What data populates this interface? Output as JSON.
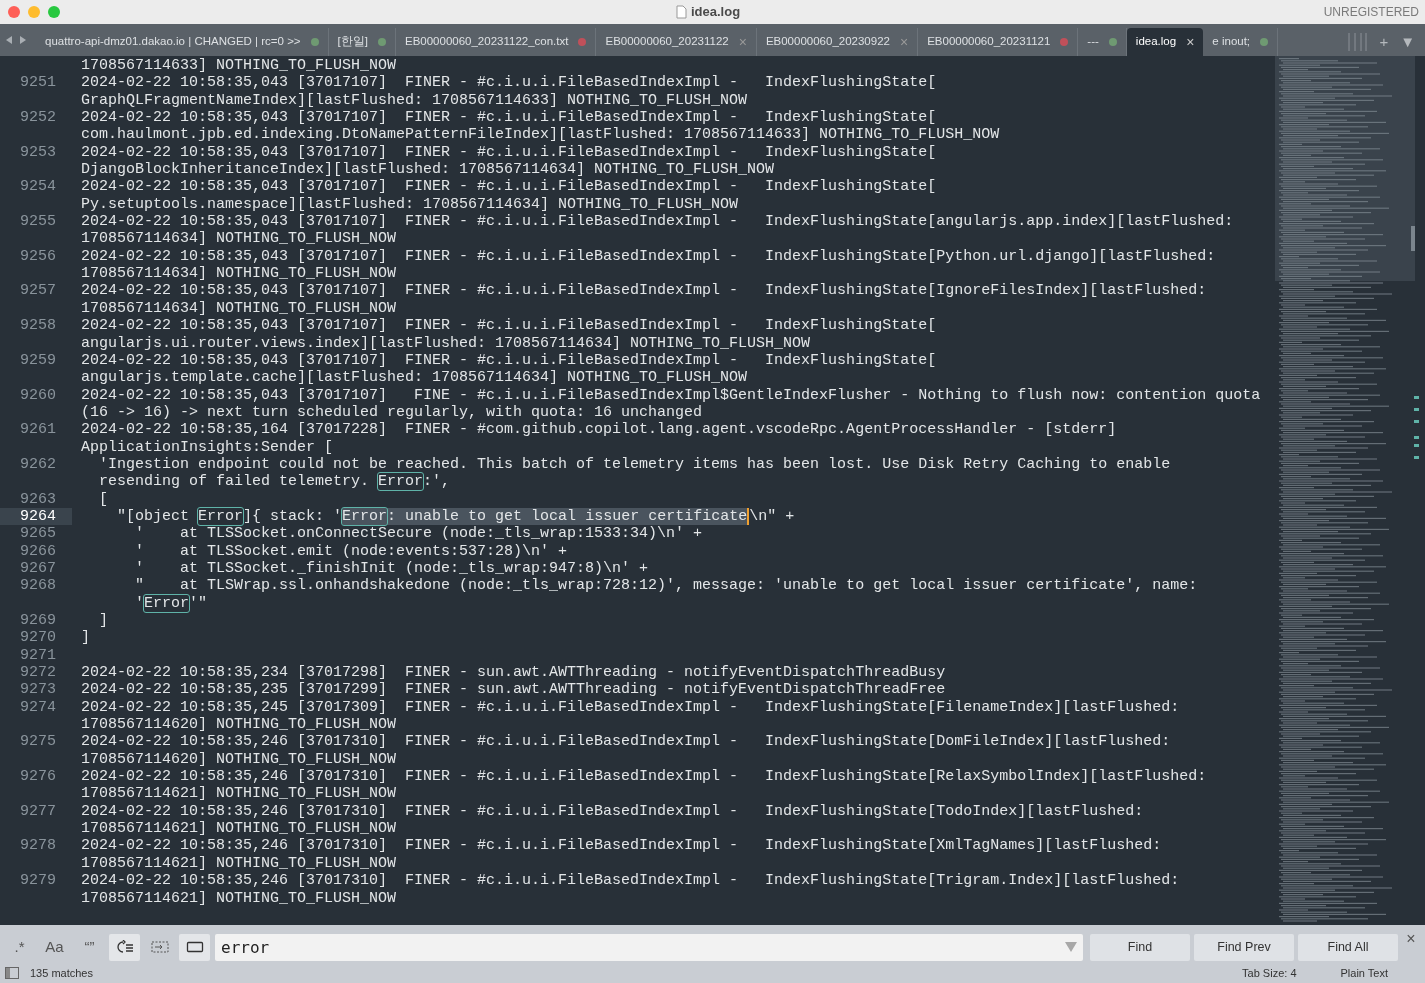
{
  "window": {
    "title": "idea.log",
    "registration": "UNREGISTERED"
  },
  "tabs": [
    {
      "label": "quattro-api-dmz01.dakao.io | CHANGED | rc=0 >>",
      "selected": false,
      "kind": "dot",
      "color": "#6f9a72"
    },
    {
      "label": "[한일]",
      "selected": false,
      "kind": "dot",
      "color": "#6f9a72"
    },
    {
      "label": "EB00000060_20231122_con.txt",
      "selected": false,
      "kind": "dot",
      "color": "#c0505a"
    },
    {
      "label": "EB00000060_20231122",
      "selected": false,
      "kind": "close",
      "close": "×"
    },
    {
      "label": "EB00000060_20230922",
      "selected": false,
      "kind": "close",
      "close": "×"
    },
    {
      "label": "EB00000060_20231121",
      "selected": false,
      "kind": "dot",
      "color": "#c0505a"
    },
    {
      "label": "---",
      "selected": false,
      "kind": "dot",
      "color": "#6f9a72"
    },
    {
      "label": "idea.log",
      "selected": true,
      "kind": "close",
      "close": "×"
    },
    {
      "label": "e inout;",
      "selected": false,
      "kind": "dot",
      "color": "#6f9a72"
    }
  ],
  "tab_actions": [
    "+",
    "▼"
  ],
  "editor": {
    "rows": [
      {
        "segments": [
          {
            "text": "1708567114633] NOTHING_TO_FLUSH_NOW"
          }
        ]
      },
      {
        "number": "9251",
        "segments": [
          {
            "text": "2024-02-22 10:58:35,043 [37017107]  FINER - #c.i.u.i.FileBasedIndexImpl -   IndexFlushingState["
          }
        ]
      },
      {
        "segments": [
          {
            "text": "GraphQLFragmentNameIndex][lastFlushed: 1708567114633] NOTHING_TO_FLUSH_NOW"
          }
        ]
      },
      {
        "number": "9252",
        "segments": [
          {
            "text": "2024-02-22 10:58:35,043 [37017107]  FINER - #c.i.u.i.FileBasedIndexImpl -   IndexFlushingState["
          }
        ]
      },
      {
        "segments": [
          {
            "text": "com.haulmont.jpb.ed.indexing.DtoNamePatternFileIndex][lastFlushed: 1708567114633] NOTHING_TO_FLUSH_NOW"
          }
        ]
      },
      {
        "number": "9253",
        "segments": [
          {
            "text": "2024-02-22 10:58:35,043 [37017107]  FINER - #c.i.u.i.FileBasedIndexImpl -   IndexFlushingState["
          }
        ]
      },
      {
        "segments": [
          {
            "text": "DjangoBlockInheritanceIndex][lastFlushed: 1708567114634] NOTHING_TO_FLUSH_NOW"
          }
        ]
      },
      {
        "number": "9254",
        "segments": [
          {
            "text": "2024-02-22 10:58:35,043 [37017107]  FINER - #c.i.u.i.FileBasedIndexImpl -   IndexFlushingState["
          }
        ]
      },
      {
        "segments": [
          {
            "text": "Py.setuptools.namespace][lastFlushed: 1708567114634] NOTHING_TO_FLUSH_NOW"
          }
        ]
      },
      {
        "number": "9255",
        "segments": [
          {
            "text": "2024-02-22 10:58:35,043 [37017107]  FINER - #c.i.u.i.FileBasedIndexImpl -   IndexFlushingState[angularjs.app.index][lastFlushed:"
          }
        ]
      },
      {
        "segments": [
          {
            "text": "1708567114634] NOTHING_TO_FLUSH_NOW"
          }
        ]
      },
      {
        "number": "9256",
        "segments": [
          {
            "text": "2024-02-22 10:58:35,043 [37017107]  FINER - #c.i.u.i.FileBasedIndexImpl -   IndexFlushingState[Python.url.django][lastFlushed:"
          }
        ]
      },
      {
        "segments": [
          {
            "text": "1708567114634] NOTHING_TO_FLUSH_NOW"
          }
        ]
      },
      {
        "number": "9257",
        "segments": [
          {
            "text": "2024-02-22 10:58:35,043 [37017107]  FINER - #c.i.u.i.FileBasedIndexImpl -   IndexFlushingState[IgnoreFilesIndex][lastFlushed:"
          }
        ]
      },
      {
        "segments": [
          {
            "text": "1708567114634] NOTHING_TO_FLUSH_NOW"
          }
        ]
      },
      {
        "number": "9258",
        "segments": [
          {
            "text": "2024-02-22 10:58:35,043 [37017107]  FINER - #c.i.u.i.FileBasedIndexImpl -   IndexFlushingState["
          }
        ]
      },
      {
        "segments": [
          {
            "text": "angularjs.ui.router.views.index][lastFlushed: 1708567114634] NOTHING_TO_FLUSH_NOW"
          }
        ]
      },
      {
        "number": "9259",
        "segments": [
          {
            "text": "2024-02-22 10:58:35,043 [37017107]  FINER - #c.i.u.i.FileBasedIndexImpl -   IndexFlushingState["
          }
        ]
      },
      {
        "segments": [
          {
            "text": "angularjs.template.cache][lastFlushed: 1708567114634] NOTHING_TO_FLUSH_NOW"
          }
        ]
      },
      {
        "number": "9260",
        "segments": [
          {
            "text": "2024-02-22 10:58:35,043 [37017107]   FINE - #c.i.u.i.FileBasedIndexImpl$GentleIndexFlusher - Nothing to flush now: contention quota"
          }
        ]
      },
      {
        "segments": [
          {
            "text": "(16 -> 16) -> next turn scheduled regularly, with quota: 16 unchanged"
          }
        ]
      },
      {
        "number": "9261",
        "segments": [
          {
            "text": "2024-02-22 10:58:35,164 [37017228]  FINER - #com.github.copilot.lang.agent.vscodeRpc.AgentProcessHandler - [stderr]"
          }
        ]
      },
      {
        "segments": [
          {
            "text": "ApplicationInsights:Sender ["
          }
        ]
      },
      {
        "number": "9262",
        "segments": [
          {
            "text": "  'Ingestion endpoint could not be reached. This batch of telemetry items has been lost. Use Disk Retry Caching to enable"
          }
        ]
      },
      {
        "segments": [
          {
            "text": "  resending of failed telemetry. "
          },
          {
            "text": "Error",
            "kind": "match"
          },
          {
            "text": ":',"
          }
        ]
      },
      {
        "number": "9263",
        "segments": [
          {
            "text": "  ["
          }
        ]
      },
      {
        "number": "9264",
        "current": true,
        "segments": [
          {
            "text": "    \"[object "
          },
          {
            "text": "Error",
            "kind": "match"
          },
          {
            "text": "]{ stack: '"
          },
          {
            "text": "Error",
            "kind": "selected_match"
          },
          {
            "text": ": unable to get local issuer certificate",
            "kind": "selected",
            "caret": true
          },
          {
            "text": "\\n\" +"
          }
        ]
      },
      {
        "number": "9265",
        "segments": [
          {
            "text": "      '    at TLSSocket.onConnectSecure (node:_tls_wrap:1533:34)\\n' +"
          }
        ]
      },
      {
        "number": "9266",
        "segments": [
          {
            "text": "      '    at TLSSocket.emit (node:events:537:28)\\n' +"
          }
        ]
      },
      {
        "number": "9267",
        "segments": [
          {
            "text": "      '    at TLSSocket._finishInit (node:_tls_wrap:947:8)\\n' +"
          }
        ]
      },
      {
        "number": "9268",
        "segments": [
          {
            "text": "      \"    at TLSWrap.ssl.onhandshakedone (node:_tls_wrap:728:12)', message: 'unable to get local issuer certificate', name:"
          }
        ]
      },
      {
        "segments": [
          {
            "text": "      '"
          },
          {
            "text": "Error",
            "kind": "match"
          },
          {
            "text": "'\""
          }
        ]
      },
      {
        "number": "9269",
        "segments": [
          {
            "text": "  ]"
          }
        ]
      },
      {
        "number": "9270",
        "segments": [
          {
            "text": "]"
          }
        ]
      },
      {
        "number": "9271",
        "segments": []
      },
      {
        "number": "9272",
        "segments": [
          {
            "text": "2024-02-22 10:58:35,234 [37017298]  FINER - sun.awt.AWTThreading - notifyEventDispatchThreadBusy"
          }
        ]
      },
      {
        "number": "9273",
        "segments": [
          {
            "text": "2024-02-22 10:58:35,235 [37017299]  FINER - sun.awt.AWTThreading - notifyEventDispatchThreadFree"
          }
        ]
      },
      {
        "number": "9274",
        "segments": [
          {
            "text": "2024-02-22 10:58:35,245 [37017309]  FINER - #c.i.u.i.FileBasedIndexImpl -   IndexFlushingState[FilenameIndex][lastFlushed:"
          }
        ]
      },
      {
        "segments": [
          {
            "text": "1708567114620] NOTHING_TO_FLUSH_NOW"
          }
        ]
      },
      {
        "number": "9275",
        "segments": [
          {
            "text": "2024-02-22 10:58:35,246 [37017310]  FINER - #c.i.u.i.FileBasedIndexImpl -   IndexFlushingState[DomFileIndex][lastFlushed:"
          }
        ]
      },
      {
        "segments": [
          {
            "text": "1708567114620] NOTHING_TO_FLUSH_NOW"
          }
        ]
      },
      {
        "number": "9276",
        "segments": [
          {
            "text": "2024-02-22 10:58:35,246 [37017310]  FINER - #c.i.u.i.FileBasedIndexImpl -   IndexFlushingState[RelaxSymbolIndex][lastFlushed:"
          }
        ]
      },
      {
        "segments": [
          {
            "text": "1708567114621] NOTHING_TO_FLUSH_NOW"
          }
        ]
      },
      {
        "number": "9277",
        "segments": [
          {
            "text": "2024-02-22 10:58:35,246 [37017310]  FINER - #c.i.u.i.FileBasedIndexImpl -   IndexFlushingState[TodoIndex][lastFlushed:"
          }
        ]
      },
      {
        "segments": [
          {
            "text": "1708567114621] NOTHING_TO_FLUSH_NOW"
          }
        ]
      },
      {
        "number": "9278",
        "segments": [
          {
            "text": "2024-02-22 10:58:35,246 [37017310]  FINER - #c.i.u.i.FileBasedIndexImpl -   IndexFlushingState[XmlTagNames][lastFlushed:"
          }
        ]
      },
      {
        "segments": [
          {
            "text": "1708567114621] NOTHING_TO_FLUSH_NOW"
          }
        ]
      },
      {
        "number": "9279",
        "segments": [
          {
            "text": "2024-02-22 10:58:35,246 [37017310]  FINER - #c.i.u.i.FileBasedIndexImpl -   IndexFlushingState[Trigram.Index][lastFlushed:"
          }
        ]
      },
      {
        "segments": [
          {
            "text": "1708567114621] NOTHING_TO_FLUSH_NOW"
          }
        ]
      }
    ]
  },
  "find_panel": {
    "options": [
      {
        "kind": "text",
        "label": ".*",
        "on": false
      },
      {
        "kind": "text",
        "label": "Aa",
        "on": false
      },
      {
        "kind": "text",
        "label": "“”",
        "on": false
      },
      {
        "kind": "wrap",
        "on": true
      },
      {
        "kind": "in_selection",
        "on": false
      },
      {
        "kind": "highlight",
        "on": true
      }
    ],
    "query": "error",
    "buttons": [
      "Find",
      "Find Prev",
      "Find All"
    ],
    "close": "×"
  },
  "status_bar": {
    "matches": "135 matches",
    "tab_size": "Tab Size: 4",
    "syntax": "Plain Text"
  }
}
